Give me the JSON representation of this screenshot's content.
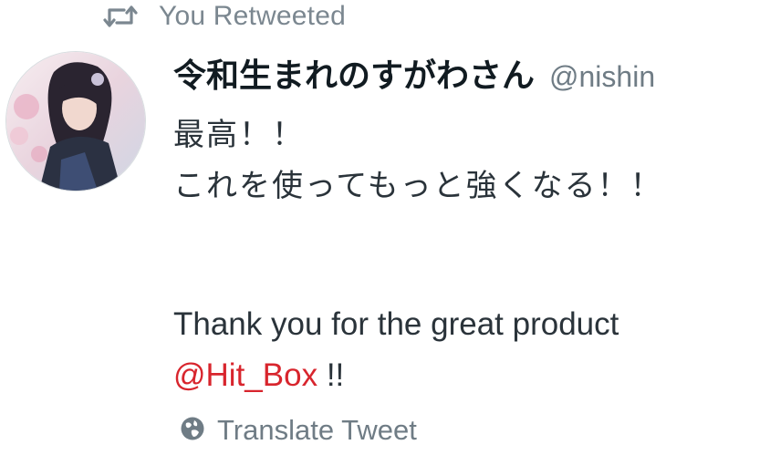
{
  "context": {
    "icon": "retweet-icon",
    "text": "You Retweeted"
  },
  "author": {
    "display_name": "令和生まれのすがわさん",
    "handle": "@nishin",
    "avatar": "profile-avatar"
  },
  "tweet": {
    "lines": [
      "最高！！",
      "これを使ってもっと強くなる！！"
    ],
    "english_line": "Thank you for the great product",
    "mention": "@Hit_Box",
    "after_mention": " !!"
  },
  "translate": {
    "icon": "globe-icon",
    "label": "Translate Tweet"
  },
  "colors": {
    "mention": "#d8252d",
    "muted": "#6f7c85",
    "text": "#2a333a"
  }
}
